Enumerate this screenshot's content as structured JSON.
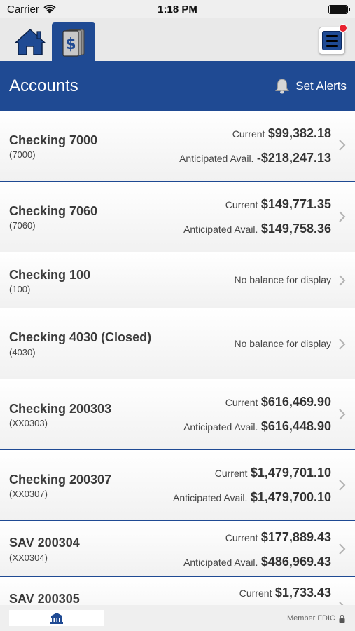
{
  "status_bar": {
    "carrier": "Carrier",
    "time": "1:18 PM"
  },
  "header": {
    "title": "Accounts",
    "alerts_label": "Set Alerts"
  },
  "accounts": [
    {
      "name": "Checking 7000",
      "number": "(7000)",
      "current_label": "Current",
      "current": "$99,382.18",
      "anticipated_label": "Anticipated Avail.",
      "anticipated": "-$218,247.13"
    },
    {
      "name": "Checking 7060",
      "number": "(7060)",
      "current_label": "Current",
      "current": "$149,771.35",
      "anticipated_label": "Anticipated Avail.",
      "anticipated": "$149,758.36"
    },
    {
      "name": "Checking 100",
      "number": "(100)",
      "no_balance": "No balance for display"
    },
    {
      "name": "Checking 4030 (Closed)",
      "number": "(4030)",
      "no_balance": "No balance for display"
    },
    {
      "name": "Checking 200303",
      "number": "(XX0303)",
      "current_label": "Current",
      "current": "$616,469.90",
      "anticipated_label": "Anticipated Avail.",
      "anticipated": "$616,448.90"
    },
    {
      "name": "Checking 200307",
      "number": "(XX0307)",
      "current_label": "Current",
      "current": "$1,479,701.10",
      "anticipated_label": "Anticipated Avail.",
      "anticipated": "$1,479,700.10"
    },
    {
      "name": "SAV 200304",
      "number": "(XX0304)",
      "current_label": "Current",
      "current": "$177,889.43",
      "anticipated_label": "Anticipated Avail.",
      "anticipated": "$486,969.43"
    },
    {
      "name": "SAV 200305",
      "current_label": "Current",
      "current": "$1,733.43"
    }
  ],
  "footer": {
    "fdic": "Member FDIC"
  },
  "icons": {
    "wifi": "wifi-icon",
    "battery": "battery-icon",
    "home": "home-icon",
    "accounts": "dollar-icon",
    "menu": "hamburger-menu-icon",
    "bell": "bell-icon",
    "chevron": "chevron-right-icon",
    "bank": "bank-icon",
    "lock": "lock-icon"
  },
  "colors": {
    "brand_blue": "#1f4a93",
    "notification_red": "#e8212e",
    "background": "#ffffff"
  }
}
